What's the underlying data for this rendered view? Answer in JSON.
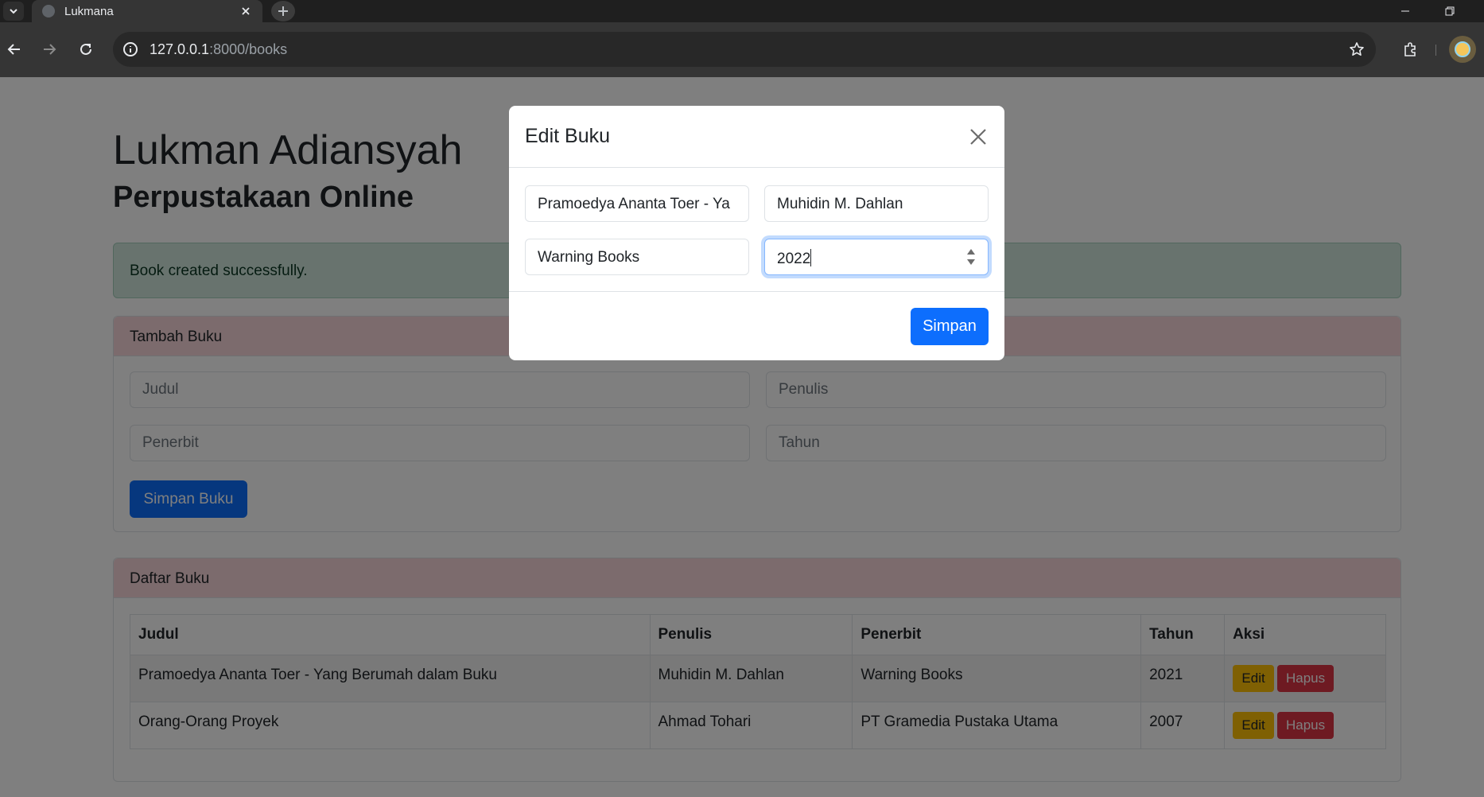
{
  "browser": {
    "tab_title": "Lukmana",
    "url_host": "127.0.0.1",
    "url_rest": ":8000/books"
  },
  "page": {
    "title": "Lukman Adiansyah",
    "subtitle": "Perpustakaan Online",
    "alert": "Book created successfully.",
    "add_card": {
      "header": "Tambah Buku",
      "placeholders": {
        "judul": "Judul",
        "penulis": "Penulis",
        "penerbit": "Penerbit",
        "tahun": "Tahun"
      },
      "submit_label": "Simpan Buku"
    },
    "list_card": {
      "header": "Daftar Buku",
      "columns": [
        "Judul",
        "Penulis",
        "Penerbit",
        "Tahun",
        "Aksi"
      ],
      "rows": [
        {
          "judul": "Pramoedya Ananta Toer - Yang Berumah dalam Buku",
          "penulis": "Muhidin M. Dahlan",
          "penerbit": "Warning Books",
          "tahun": "2021"
        },
        {
          "judul": "Orang-Orang Proyek",
          "penulis": "Ahmad Tohari",
          "penerbit": "PT Gramedia Pustaka Utama",
          "tahun": "2007"
        }
      ],
      "edit_label": "Edit",
      "delete_label": "Hapus"
    }
  },
  "modal": {
    "title": "Edit Buku",
    "fields": {
      "judul": "Pramoedya Ananta Toer - Ya",
      "penulis": "Muhidin M. Dahlan",
      "penerbit": "Warning Books",
      "tahun": "2022"
    },
    "save_label": "Simpan"
  },
  "colors": {
    "primary": "#0d6efd",
    "warning": "#ffc107",
    "danger": "#dc3545",
    "alert_success_bg": "#d1e7dd",
    "card_header_bg": "#f8d7da"
  }
}
